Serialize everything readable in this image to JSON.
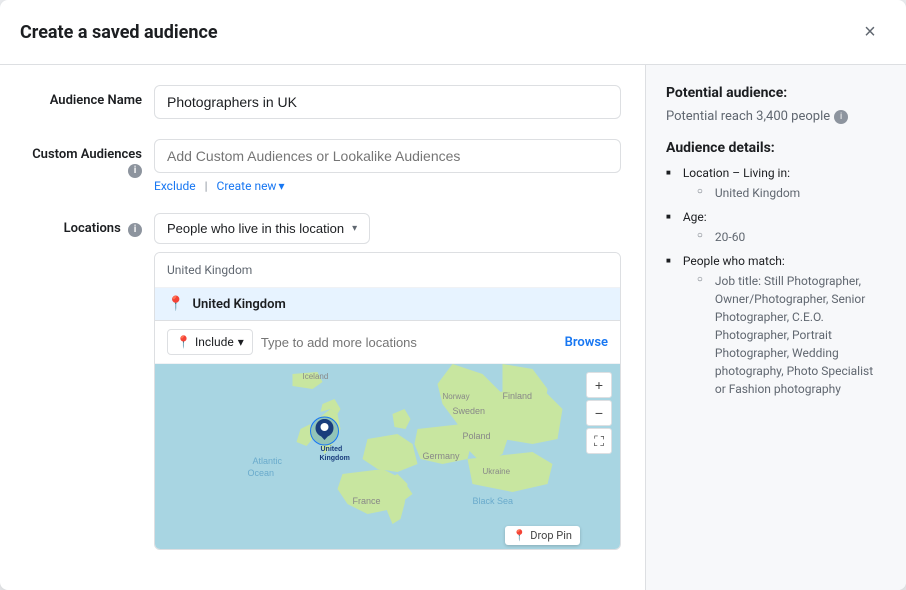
{
  "modal": {
    "title": "Create a saved audience",
    "close_label": "×"
  },
  "form": {
    "audience_name_label": "Audience Name",
    "audience_name_value": "Photographers in UK",
    "audience_name_placeholder": "Photographers in UK",
    "custom_audiences_label": "Custom Audiences",
    "custom_audiences_placeholder": "Add Custom Audiences or Lookalike Audiences",
    "exclude_label": "Exclude",
    "create_new_label": "Create new",
    "locations_label": "Locations",
    "location_dropdown_value": "People who live in this location",
    "location_header_text": "United Kingdom",
    "location_item_text": "United Kingdom",
    "include_label": "Include",
    "add_locations_placeholder": "Type to add more locations",
    "browse_label": "Browse",
    "drop_pin_label": "Drop Pin"
  },
  "sidebar": {
    "potential_title": "Potential audience:",
    "reach_text": "Potential reach 3,400 people",
    "details_title": "Audience details:",
    "details": [
      {
        "label": "Location – Living in:",
        "sub": [
          "United Kingdom"
        ]
      },
      {
        "label": "Age:",
        "sub": [
          "20-60"
        ]
      },
      {
        "label": "People who match:",
        "sub": [
          "Job title: Still Photographer, Owner/Photographer, Senior Photographer, C.E.O. Photographer, Portrait Photographer, Wedding photography, Photo Specialist or Fashion photography"
        ]
      }
    ]
  },
  "icons": {
    "close": "✕",
    "arrow_down": "▾",
    "pin": "📍",
    "info": "i",
    "plus": "+",
    "minus": "−",
    "fullscreen": "⛶"
  }
}
